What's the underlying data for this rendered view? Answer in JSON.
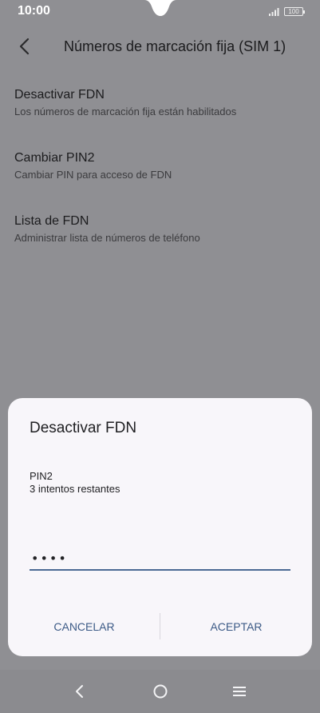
{
  "status_bar": {
    "time": "10:00",
    "battery": "100",
    "icons": [
      "signal-icon",
      "battery-icon"
    ]
  },
  "header": {
    "title": "Números de marcación fija (SIM 1)",
    "back_icon": "back-arrow-icon"
  },
  "settings": [
    {
      "title": "Desactivar FDN",
      "subtitle": "Los números de marcación fija están habilitados"
    },
    {
      "title": "Cambiar PIN2",
      "subtitle": "Cambiar PIN para acceso de FDN"
    },
    {
      "title": "Lista de FDN",
      "subtitle": "Administrar lista de números de teléfono"
    }
  ],
  "dialog": {
    "title": "Desactivar FDN",
    "field_label": "PIN2",
    "attempts": "3 intentos restantes",
    "input_value": "••••",
    "cancel_label": "CANCELAR",
    "accept_label": "ACEPTAR"
  },
  "nav_bar": {
    "icons": [
      "back-icon",
      "home-icon",
      "menu-icon"
    ]
  },
  "colors": {
    "dim_background": "#8f8f93",
    "dialog_background": "#f8f6fa",
    "accent": "#3c5a86",
    "input_underline": "#4b6a94"
  }
}
